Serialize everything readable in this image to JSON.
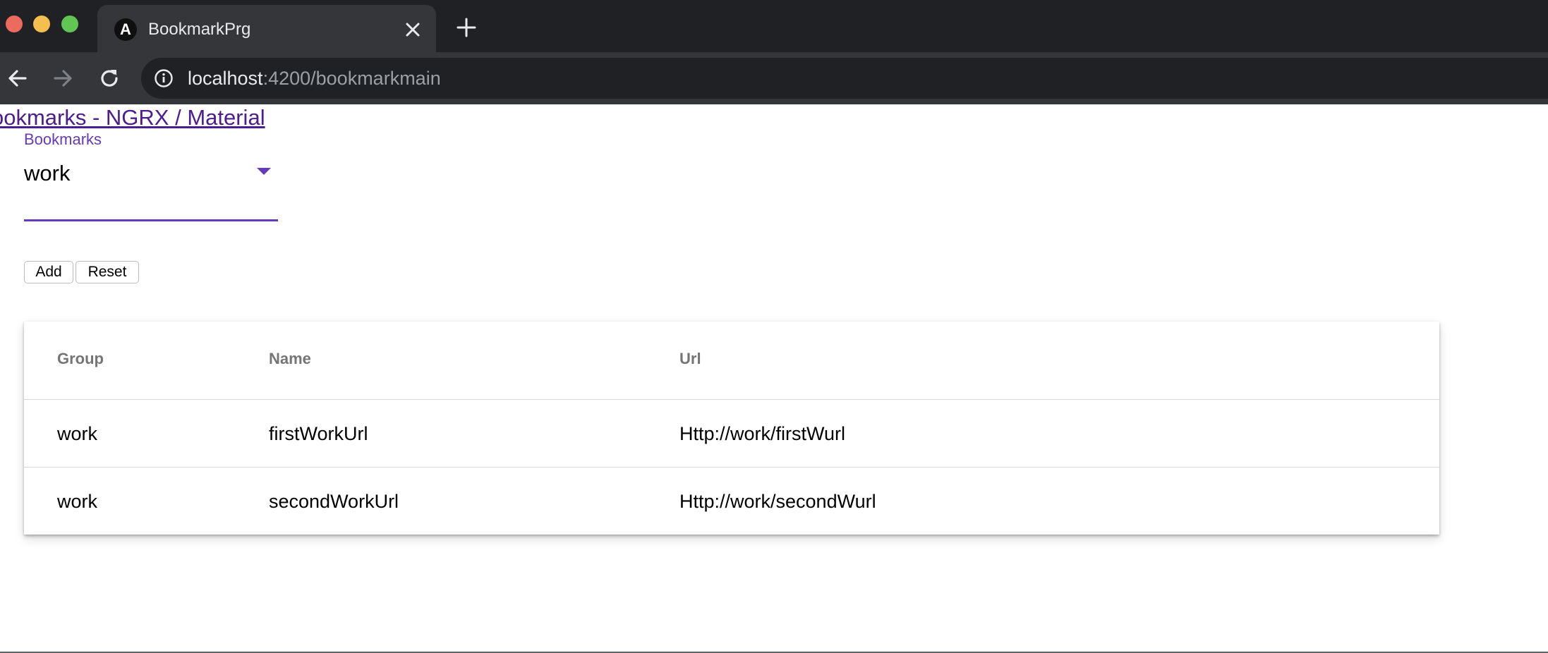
{
  "browser": {
    "tab": {
      "title": "BookmarkPrg",
      "favicon_letter": "A"
    },
    "address": {
      "host": "localhost",
      "rest": ":4200/bookmarkmain"
    }
  },
  "app": {
    "title": "ookmarks - NGRX / Material"
  },
  "select": {
    "label": "Bookmarks",
    "value": "work"
  },
  "buttons": {
    "add": "Add",
    "reset": "Reset"
  },
  "table": {
    "headers": [
      "Group",
      "Name",
      "Url"
    ],
    "rows": [
      [
        "work",
        "firstWorkUrl",
        "Http://work/firstWurl"
      ],
      [
        "work",
        "secondWorkUrl",
        "Http://work/secondWurl"
      ]
    ]
  },
  "colors": {
    "accent": "#673ab7",
    "link": "#4b1d8f",
    "chrome_dark": "#202124",
    "chrome_mid": "#35363a"
  },
  "icons": [
    "close-icon",
    "plus-icon",
    "back-arrow-icon",
    "forward-arrow-icon",
    "reload-icon",
    "info-icon",
    "angular-logo-icon",
    "dropdown-arrow-icon"
  ]
}
